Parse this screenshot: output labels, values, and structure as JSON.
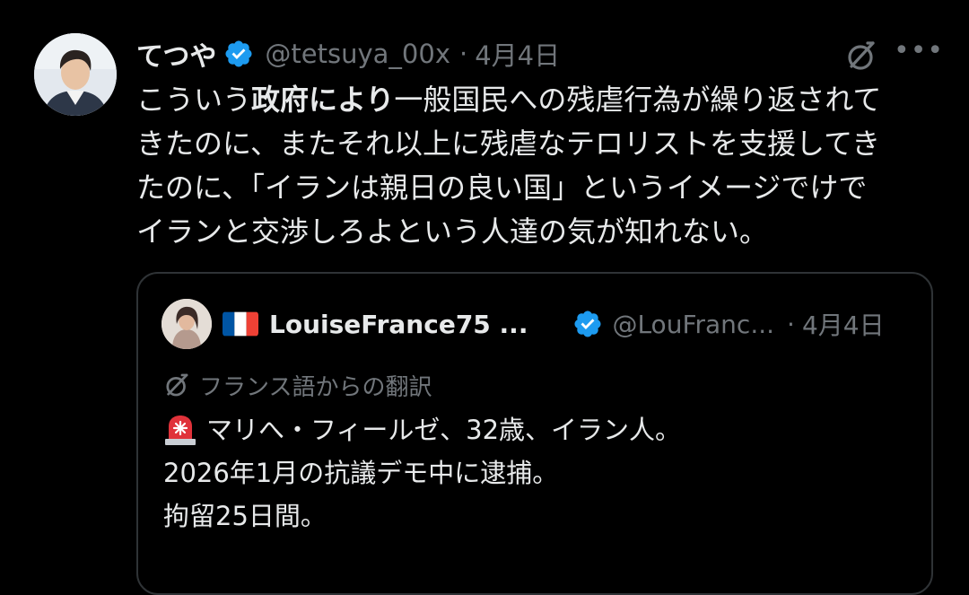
{
  "tweet": {
    "author_name": "てつや",
    "handle": "@tetsuya_00x",
    "separator": "·",
    "date": "4月4日",
    "text_lines": [
      {
        "pre": "こういう",
        "bold": "政府により",
        "post": "一般国民への残虐行為が繰り返されて"
      },
      {
        "pre": "きたのに、またそれ以上に残虐なテロリストを支援してき",
        "bold": "",
        "post": ""
      },
      {
        "pre": "たのに、「イランは親日の良い国」というイメージでけで",
        "bold": "",
        "post": ""
      },
      {
        "pre": "イランと交渉しろよという人達の気が知れない。",
        "bold": "",
        "post": ""
      }
    ],
    "more_label": "•••"
  },
  "quote": {
    "author_name": "LouiseFrance75 ...",
    "handle": "@LouFranc...",
    "separator": "·",
    "date": "4月4日",
    "translated_label": "フランス語からの翻訳",
    "text_lines": [
      "マリへ・フィールゼ、32歳、イラン人。",
      "2026年1月の抗議デモ中に逮捕。",
      "拘留25日間。"
    ]
  },
  "icons": {
    "verified": "verified-badge-icon",
    "translate": "translate-icon",
    "more": "more-options-icon",
    "flag": "france-flag-icon",
    "siren": "siren-emoji-icon"
  },
  "colors": {
    "background": "#000000",
    "text": "#e7e9ea",
    "secondary": "#71767b",
    "verified_blue": "#1d9bf0",
    "border": "#2f3336"
  }
}
